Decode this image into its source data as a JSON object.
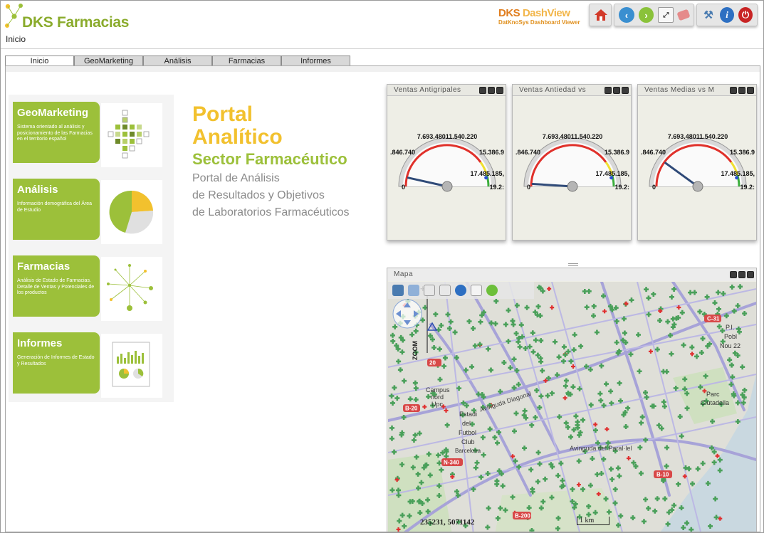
{
  "header": {
    "app_title": "DKS Farmacias",
    "breadcrumb": "Inicio",
    "dash_logo": {
      "brand": "DKS",
      "product": "DashView",
      "subtitle": "DatKnoSys Dashboard Viewer"
    },
    "toolbar_icons": [
      "home-icon",
      "back-icon",
      "forward-icon",
      "zoom-icon",
      "eraser-icon",
      "tools-icon",
      "info-icon",
      "power-icon"
    ]
  },
  "tabs": [
    "Inicio",
    "GeoMarketing",
    "Análisis",
    "Farmacias",
    "Informes"
  ],
  "active_tab": "Inicio",
  "menu": [
    {
      "title": "GeoMarketing",
      "desc": "Sistema orientado al análisis y posicionamiento de las Farmacias en el territorio español"
    },
    {
      "title": "Análisis",
      "desc": "Información demográfica del Área de Estudio"
    },
    {
      "title": "Farmacias",
      "desc": "Análisis de Estado de Farmacias. Detalle de Ventas y Potenciales de los productos"
    },
    {
      "title": "Informes",
      "desc": "Generación de Informes de Estado y Resultados"
    }
  ],
  "portal": {
    "line1": "Portal",
    "line2": "Analítico",
    "line3": "Sector Farmacéutico",
    "line4": "Portal de Análisis",
    "line5": "de Resultados y Objetivos",
    "line6": "de Laboratorios Farmacéuticos"
  },
  "gauges": [
    {
      "title": "Ventas Antigripales",
      "top_label": "7.693.48011.540.220",
      "left_label": ".846.740",
      "right_label": "15.386.9",
      "lower_right": "17.485.185,",
      "zero": "0",
      "max": "19.2:",
      "needle_fraction": 0.07
    },
    {
      "title": "Ventas Antiedad vs",
      "top_label": "7.693.48011.540.220",
      "left_label": ".846.740",
      "right_label": "15.386.9",
      "lower_right": "17.485.185,",
      "zero": "0",
      "max": "19.2:",
      "needle_fraction": 0.02
    },
    {
      "title": "Ventas Medias vs M",
      "top_label": "7.693.48011.540.220",
      "left_label": ".846.740",
      "right_label": "15.386.9",
      "lower_right": "17.485.185,",
      "zero": "0",
      "max": "19.2:",
      "needle_fraction": 0.2
    }
  ],
  "map": {
    "title": "Mapa",
    "coords": "235231, 5071142",
    "scale": "1 km",
    "zoom_label": "ZOOM",
    "labels": [
      "Campus",
      "nord",
      "Upc",
      "Estadi",
      "del",
      "Futbol",
      "Club",
      "Barcelona",
      "Parc",
      "Ciutadella",
      "Avinguda Diagonal",
      "Avinguda del Paral·lel",
      "B-20",
      "N-340",
      "B-10",
      "C-31",
      "B-200",
      "Pobl",
      "Nou 22",
      "P.I."
    ]
  },
  "colors": {
    "green": "#9cc03a",
    "yellow": "#f2c12e",
    "orange": "#e07d1e"
  }
}
